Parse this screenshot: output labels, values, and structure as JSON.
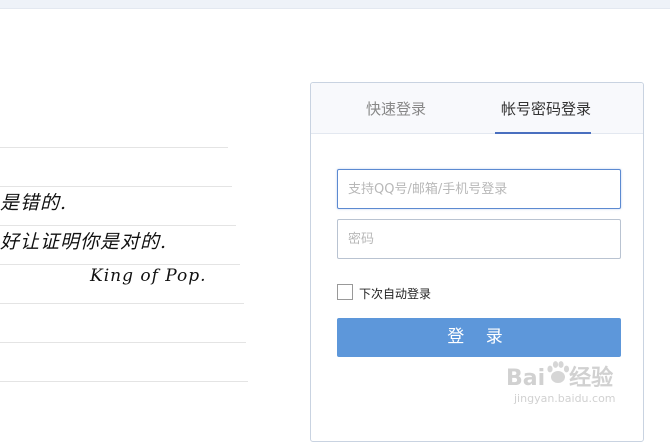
{
  "login": {
    "tabs": [
      {
        "label": "快速登录",
        "active": false
      },
      {
        "label": "帐号密码登录",
        "active": true
      }
    ],
    "username_placeholder": "支持QQ号/邮箱/手机号登录",
    "password_placeholder": "密码",
    "remember_label": "下次自动登录",
    "remember_checked": false,
    "submit_label": "登 录"
  },
  "background_note": {
    "lines": [
      "是错的.",
      "好让证明你是对的.",
      "King of Pop."
    ]
  },
  "watermark": {
    "brand_left": "Bai",
    "brand_right": "经验",
    "url": "jingyan.baidu.com"
  },
  "colors": {
    "accent": "#5d97da",
    "tab_underline": "#4a6fbf",
    "border": "#c9d3e1"
  }
}
